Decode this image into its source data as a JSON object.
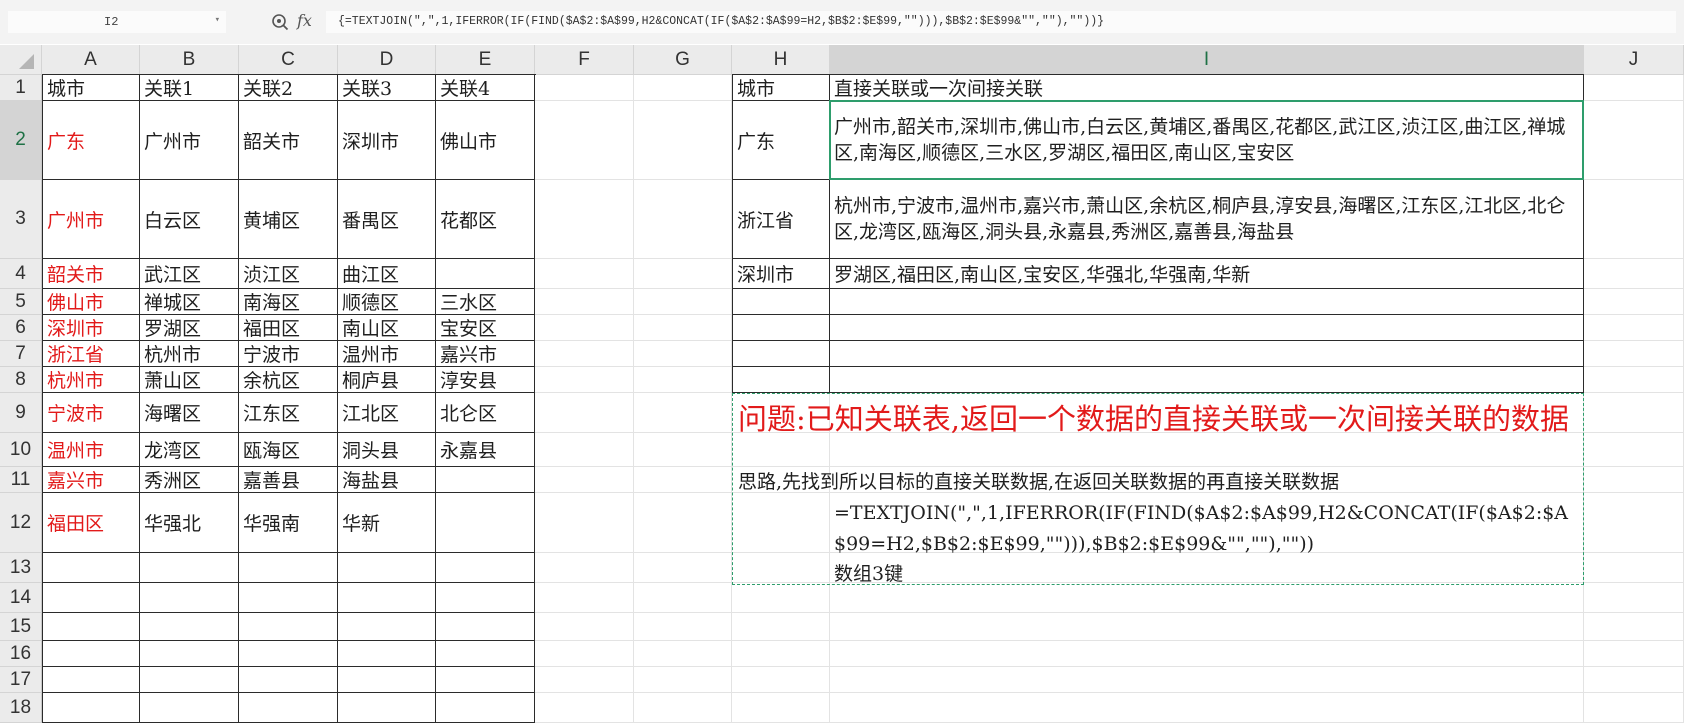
{
  "toolbar": {
    "name_box": "I2",
    "fx_label": "fx",
    "formula": "{=TEXTJOIN(\",\",1,IFERROR(IF(FIND($A$2:$A$99,H2&CONCAT(IF($A$2:$A$99=H2,$B$2:$E$99,\"\"))),$B$2:$E$99&\"\",\"\"),\"\"))}"
  },
  "columns": [
    "A",
    "B",
    "C",
    "D",
    "E",
    "F",
    "G",
    "H",
    "I",
    "J"
  ],
  "rows": [
    "1",
    "2",
    "3",
    "4",
    "5",
    "6",
    "7",
    "8",
    "9",
    "10",
    "11",
    "12",
    "13",
    "14",
    "15",
    "16",
    "17",
    "18"
  ],
  "table": {
    "headers": [
      "城市",
      "关联1",
      "关联2",
      "关联3",
      "关联4"
    ],
    "rows": [
      [
        "广东",
        "广州市",
        "韶关市",
        "深圳市",
        "佛山市"
      ],
      [
        "广州市",
        "白云区",
        "黄埔区",
        "番禺区",
        "花都区"
      ],
      [
        "韶关市",
        "武江区",
        "浈江区",
        "曲江区",
        ""
      ],
      [
        "佛山市",
        "禅城区",
        "南海区",
        "顺德区",
        "三水区"
      ],
      [
        "深圳市",
        "罗湖区",
        "福田区",
        "南山区",
        "宝安区"
      ],
      [
        "浙江省",
        "杭州市",
        "宁波市",
        "温州市",
        "嘉兴市"
      ],
      [
        "杭州市",
        "萧山区",
        "余杭区",
        "桐庐县",
        "淳安县"
      ],
      [
        "宁波市",
        "海曙区",
        "江东区",
        "江北区",
        "北仑区"
      ],
      [
        "温州市",
        "龙湾区",
        "瓯海区",
        "洞头县",
        "永嘉县"
      ],
      [
        "嘉兴市",
        "秀洲区",
        "嘉善县",
        "海盐县",
        ""
      ],
      [
        "福田区",
        "华强北",
        "华强南",
        "华新",
        ""
      ]
    ]
  },
  "result": {
    "headers": [
      "城市",
      "直接关联或一次间接关联"
    ],
    "rows": [
      [
        "广东",
        "广州市,韶关市,深圳市,佛山市,白云区,黄埔区,番禺区,花都区,武江区,浈江区,曲江区,禅城区,南海区,顺德区,三水区,罗湖区,福田区,南山区,宝安区"
      ],
      [
        "浙江省",
        "杭州市,宁波市,温州市,嘉兴市,萧山区,余杭区,桐庐县,淳安县,海曙区,江东区,江北区,北仑区,龙湾区,瓯海区,洞头县,永嘉县,秀洲区,嘉善县,海盐县"
      ],
      [
        "深圳市",
        "罗湖区,福田区,南山区,宝安区,华强北,华强南,华新"
      ]
    ]
  },
  "notes": {
    "question": "问题:已知关联表,返回一个数据的直接关联或一次间接关联的数据",
    "approach": "思路,先找到所以目标的直接关联数据,在返回关联数据的再直接关联数据",
    "formula": "=TEXTJOIN(\",\",1,IFERROR(IF(FIND($A$2:$A$99,H2&CONCAT(IF($A$2:$A$99=H2,$B$2:$E$99,\"\"))),$B$2:$E$99&\"\",\"\"),\"\"))",
    "array_key": "数组3键"
  },
  "colors": {
    "accent_green": "#1e7145",
    "selection_border": "#2e9d6c",
    "red_text": "#e21a1a"
  }
}
